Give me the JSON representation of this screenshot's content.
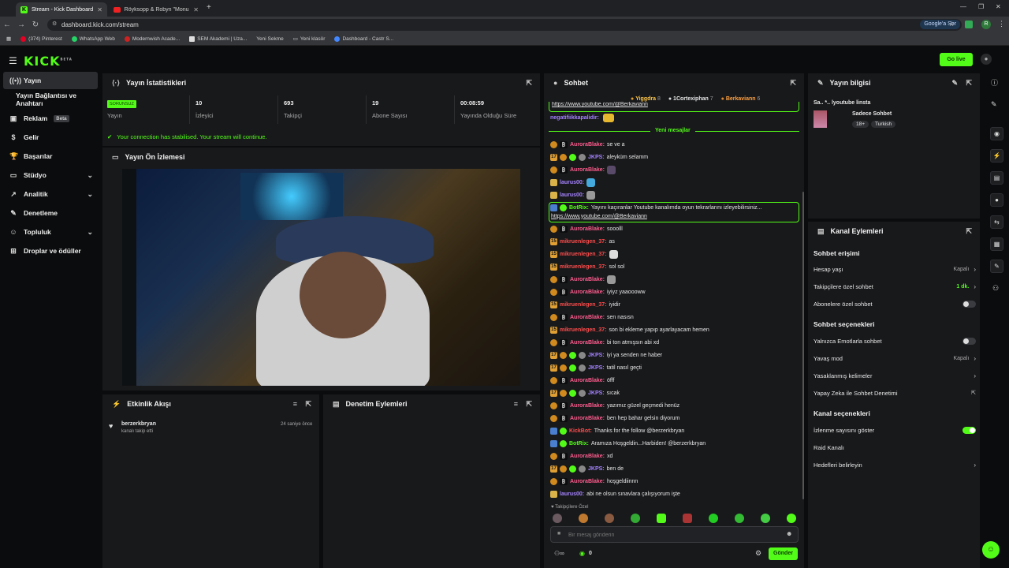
{
  "browser": {
    "tabs": [
      {
        "title": "Stream - Kick Dashboard"
      },
      {
        "title": "Röyksopp & Robyn \"Monume"
      }
    ],
    "url": "dashboard.kick.com/stream",
    "google_btn": "Google'a Sor",
    "profile_letter": "R",
    "bookmarks": [
      "(374) Pinterest",
      "WhatsApp Web",
      "Modernwish Acade...",
      "SEM Akademi | Uza...",
      "Yeni Sekme",
      "Yeni klasör",
      "Dashboard - Castr S..."
    ]
  },
  "header": {
    "logo": "KICK",
    "logo_sup": "BETA",
    "golive": "Go live"
  },
  "sidebar": {
    "items": [
      {
        "label": "Yayın",
        "icon": "broadcast-icon"
      },
      {
        "label": "Yayın Bağlantısı ve Anahtarı",
        "icon": ""
      },
      {
        "label": "Reklam",
        "icon": "ad-icon",
        "badge": "Beta"
      },
      {
        "label": "Gelir",
        "icon": "revenue-icon"
      },
      {
        "label": "Başarılar",
        "icon": "trophy-icon"
      },
      {
        "label": "Stüdyo",
        "icon": "studio-icon"
      },
      {
        "label": "Analitik",
        "icon": "analytics-icon"
      },
      {
        "label": "Denetleme",
        "icon": "wrench-icon"
      },
      {
        "label": "Topluluk",
        "icon": "community-icon"
      },
      {
        "label": "Droplar ve ödüller",
        "icon": "gift-icon"
      }
    ]
  },
  "stats": {
    "title": "Yayın İstatistikleri",
    "items": [
      {
        "value": "SORUNSUZ",
        "label": "Yayın"
      },
      {
        "value": "10",
        "label": "İzleyici"
      },
      {
        "value": "693",
        "label": "Takipçi"
      },
      {
        "value": "19",
        "label": "Abone Sayısı"
      },
      {
        "value": "00:08:59",
        "label": "Yayında Olduğu Süre"
      }
    ],
    "status": "Your connection has stabilised. Your stream will continue."
  },
  "preview": {
    "title": "Yayın Ön İzlemesi"
  },
  "activity": {
    "title": "Etkinlik Akışı",
    "event_user": "berzerkbryan",
    "event_desc": "kanalı takip etti",
    "event_time": "24 saniye önce"
  },
  "moderation": {
    "title": "Denetim Eylemleri"
  },
  "chat": {
    "title": "Sohbet",
    "top": [
      {
        "name": "Yiggdra",
        "count": "8"
      },
      {
        "name": "1Cortexiphan",
        "count": "7"
      },
      {
        "name": "Berkaviann",
        "count": "6"
      }
    ],
    "pinned_link": "https://www.youtube.com/@Berkaviann",
    "first_user": "negatifiikkapalidir:",
    "new_msgs": "Yeni mesajlar",
    "messages": [
      {
        "user": "AuroraBlake:",
        "text": "se ve a"
      },
      {
        "user": "JKPS:",
        "text": "aleyküm selamm"
      },
      {
        "user": "AuroraBlake:",
        "text": ""
      },
      {
        "user": "laurus00:",
        "text": ""
      },
      {
        "user": "laurus00:",
        "text": ""
      },
      {
        "user": "BotRix:",
        "text": "Yayını kaçıranlar Youtube kanalımda oyun tekrarlarını izleyebilirsiniz...",
        "link": "https://www.youtube.com/@Berkaviann"
      },
      {
        "user": "AuroraBlake:",
        "text": "sooolll"
      },
      {
        "user": "mikruenlegen_37:",
        "text": "as"
      },
      {
        "user": "mikruenlegen_37:",
        "text": ""
      },
      {
        "user": "mikruenlegen_37:",
        "text": "sol sol"
      },
      {
        "user": "AuroraBlake:",
        "text": ""
      },
      {
        "user": "AuroraBlake:",
        "text": "iyiyz yaaoooww"
      },
      {
        "user": "mikruenlegen_37:",
        "text": "iyidir"
      },
      {
        "user": "AuroraBlake:",
        "text": "sen nasısn"
      },
      {
        "user": "mikruenlegen_37:",
        "text": "son bi ekleme yapıp ayarlayacam hemen"
      },
      {
        "user": "AuroraBlake:",
        "text": "bi ton atmışsın abi xd"
      },
      {
        "user": "JKPS:",
        "text": "iyi ya senden ne haber"
      },
      {
        "user": "JKPS:",
        "text": "tatil nasıl geçti"
      },
      {
        "user": "AuroraBlake:",
        "text": "öfff"
      },
      {
        "user": "JKPS:",
        "text": "sıcak"
      },
      {
        "user": "AuroraBlake:",
        "text": "yazımız güzel geçmedi henüz"
      },
      {
        "user": "AuroraBlake:",
        "text": "ben hep bahar gelsin diyorum"
      },
      {
        "user": "KickBot:",
        "text": "Thanks for the follow @berzerkbryan"
      },
      {
        "user": "BotRix:",
        "text": "Aramıza Hoşgeldin...Harbiden! @berzerkbryan"
      },
      {
        "user": "AuroraBlake:",
        "text": "xd"
      },
      {
        "user": "JKPS:",
        "text": "ben de"
      },
      {
        "user": "AuroraBlake:",
        "text": "hoşgeldiinnn"
      },
      {
        "user": "laurus00:",
        "text": "abi ne olsun sınavlara çalışıyorum işte"
      }
    ],
    "followers_only": "Takipçilere Özel",
    "placeholder": "Bir mesaj gönderin",
    "count": "0",
    "send": "Gönder"
  },
  "info": {
    "title": "Yayın bilgisi",
    "stream_title": "Sa.. *.. lyoutube linsta",
    "category": "Sadece Sohbet",
    "tag1": "18+",
    "tag2": "Turkish"
  },
  "actions": {
    "title": "Kanal Eylemleri",
    "sec1": "Sohbet erişimi",
    "r1": "Hesap yaşı",
    "r1v": "Kapalı",
    "r2": "Takipçilere özel sohbet",
    "r2v": "1 dk.",
    "r3": "Abonelere özel sohbet",
    "sec2": "Sohbet seçenekleri",
    "r4": "Yalnızca Emotlarla sohbet",
    "r5": "Yavaş mod",
    "r5v": "Kapalı",
    "r6": "Yasaklanmış kelimeler",
    "r7": "Yapay Zeka ile Sohbet Denetimi",
    "sec3": "Kanal seçenekleri",
    "r8": "İzlenme sayısını göster",
    "r9": "Raid Kanalı",
    "r10": "Hedefleri belirleyin"
  }
}
